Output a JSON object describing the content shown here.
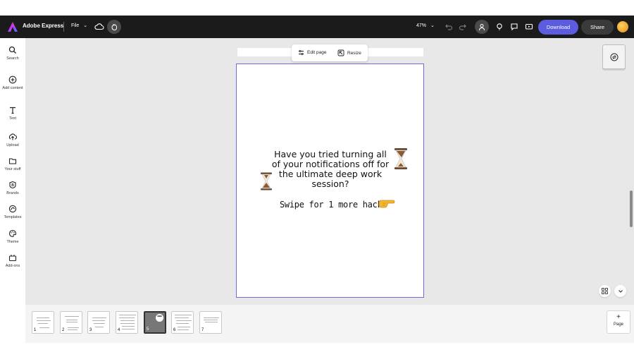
{
  "topbar": {
    "app_title": "Adobe Express",
    "file_label": "File",
    "file_chevron": "⌄",
    "zoom_label": "47%",
    "zoom_chevron": "⌄",
    "download_label": "Download",
    "share_label": "Share"
  },
  "sidebar": {
    "items": [
      {
        "label": "Search",
        "icon": "search-icon"
      },
      {
        "label": "Add content",
        "icon": "plus-circle-icon"
      },
      {
        "label": "Text",
        "icon": "text-icon"
      },
      {
        "label": "Upload",
        "icon": "upload-icon"
      },
      {
        "label": "Your stuff",
        "icon": "folder-icon"
      },
      {
        "label": "Brands",
        "icon": "brand-icon"
      },
      {
        "label": "Templates",
        "icon": "templates-icon"
      },
      {
        "label": "Theme",
        "icon": "palette-icon"
      },
      {
        "label": "Add-ons",
        "icon": "addons-icon"
      }
    ]
  },
  "page_toolbar": {
    "edit_page_label": "Edit page",
    "resize_label": "Resize"
  },
  "design": {
    "question": "Have you tried turning all of your notifications off for the ultimate deep work session?",
    "swipe_text": "Swipe for 1 more hack"
  },
  "filmstrip": {
    "pages": [
      {
        "num": "1"
      },
      {
        "num": "2"
      },
      {
        "num": "3"
      },
      {
        "num": "4"
      },
      {
        "num": "5",
        "selected": true
      },
      {
        "num": "6"
      },
      {
        "num": "7"
      }
    ],
    "more_label": "•••",
    "add_page_symbol": "+",
    "add_page_label": "Page"
  },
  "colors": {
    "accent": "#5c5ce0",
    "topbar_bg": "#1b1b1b",
    "canvas_bg": "#e8e8e8",
    "page_border": "#6b6bdf"
  }
}
